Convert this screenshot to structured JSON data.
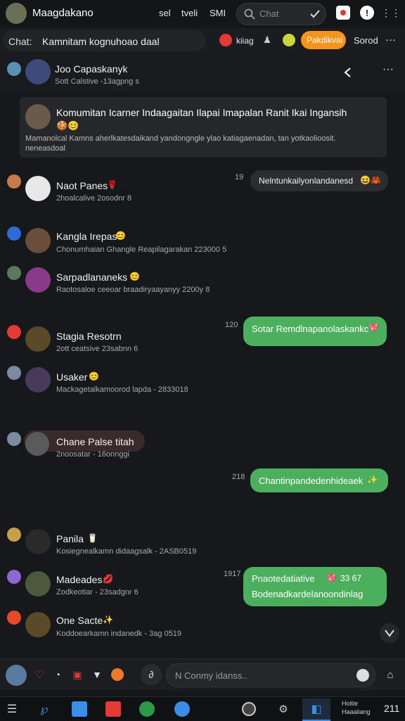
{
  "header": {
    "app_title": "Maagdakano",
    "tabs": [
      "sel",
      "tveli",
      "SMI"
    ],
    "search_placeholder": "Chat"
  },
  "chat_header": {
    "label": "Chat:",
    "subtitle": "Kamnitam kognuhoao daal",
    "tag_label": "kiiag",
    "orange_button": "Pakdikvai",
    "right_label": "Sorod"
  },
  "group": {
    "title": "Joo Capaskanyk",
    "subtitle": "Sott Calstive -13agpng s"
  },
  "pinned": {
    "title": "Komumitan Icarner Indaagaitan Ilapai Imapalan Ranit Ikai Ingansih",
    "text": "Mamanolcal Kamns aherlkatesdaikand yandongngle ylao katiagaenadan, tan yotkaolioosit.",
    "more": "neneasdoal"
  },
  "messages": [
    {
      "name": "Naot Panes",
      "sub": "2hoalcalive 2osodnr 8",
      "emoji": "🌹"
    },
    {
      "name": "Kangla Irepas",
      "sub": "Chonumhaian Ghangle Reapilagarakan 223000 5",
      "emoji": "😊"
    },
    {
      "name": "Sarpadlananeks",
      "sub": "Raotosaloe ceeoar braadiryaayanyy 2200y 8",
      "emoji": "😊"
    },
    {
      "name": "Stagia Resotrn",
      "sub": "2ott ceatsive 23sabnn 6",
      "emoji": ""
    },
    {
      "name": "Usaker",
      "sub": "Mackagetalkamoorod lapda - 2833018",
      "emoji": "😊"
    },
    {
      "name": "Chane Palse titah",
      "sub": "2noosatar - 16onnggi",
      "emoji": ""
    },
    {
      "name": "Panila",
      "sub": "Kosiegnealkamn didaagsalk - 2ASB0519",
      "emoji": "🥛"
    },
    {
      "name": "Madeades",
      "sub": "Zodkeotiar - 23sadgnr 6",
      "emoji": "💋"
    },
    {
      "name": "One Sacte",
      "sub": "Koddoearkamn indanedk - 3ag 0519",
      "emoji": "✨"
    }
  ],
  "right_bubbles": [
    {
      "time": "19",
      "text": "Nelntunkailyonlandanesd",
      "emoji": "😆🦀"
    },
    {
      "time": "120",
      "text": "Sotar Remdlnapanolaskankc",
      "emoji": "💖"
    },
    {
      "time": "218",
      "text": "Chantinpandedenhideaek",
      "emoji": "✨"
    },
    {
      "time": "1917",
      "text": "Pnaotedatiative",
      "line2": "Bodenadkardelanoondinlag",
      "extra": "33 67",
      "emoji": "💖"
    }
  ],
  "composer": {
    "placeholder": "N Conmy idanss.."
  },
  "taskbar": {
    "time_line1": "Hoitie",
    "time_line2": "Haaaiiang",
    "clock": "211"
  },
  "colors": {
    "accent_green": "#4caf5d",
    "orange": "#f7941d",
    "background": "#17181b"
  }
}
